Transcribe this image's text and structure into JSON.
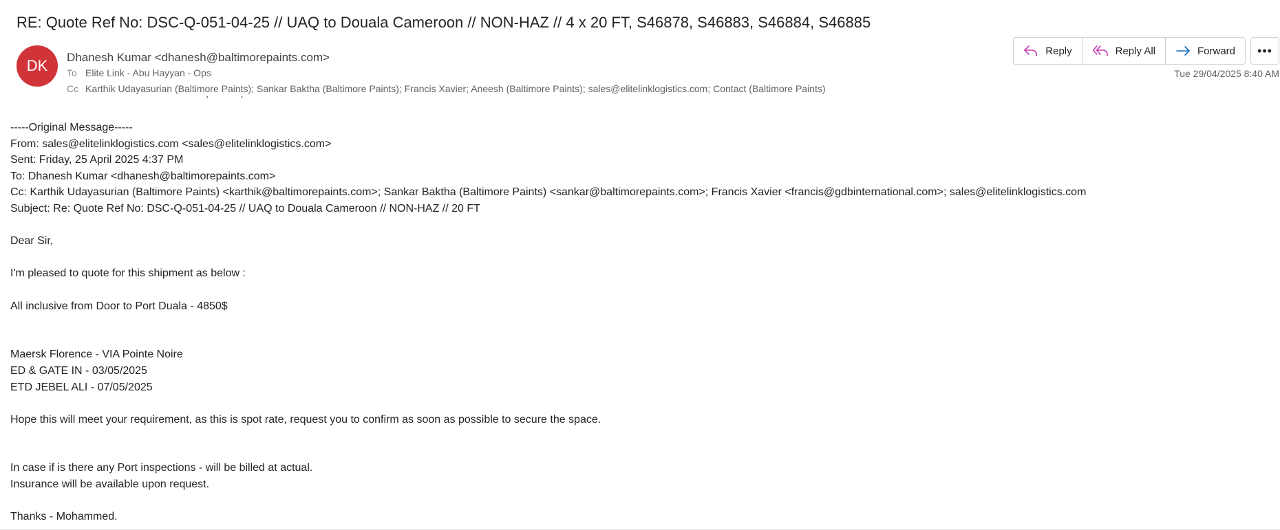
{
  "subject": "RE: Quote Ref No: DSC-Q-051-04-25 // UAQ to Douala Cameroon // NON-HAZ // 4 x 20 FT, S46878, S46883, S46884, S46885",
  "sender": {
    "initials": "DK",
    "avatar_color": "#d13438",
    "display": "Dhanesh Kumar <dhanesh@baltimorepaints.com>"
  },
  "to": {
    "label": "To",
    "value": "Elite Link - Abu Hayyan - Ops"
  },
  "cc": {
    "label": "Cc",
    "value": "Karthik Udayasurian (Baltimore Paints); Sankar Baktha (Baltimore Paints); Francis Xavier; Aneesh (Baltimore Paints); sales@elitelinklogistics.com; Contact (Baltimore Paints)"
  },
  "actions": {
    "reply": "Reply",
    "reply_all": "Reply All",
    "forward": "Forward",
    "more": "•••"
  },
  "timestamp": "Tue 29/04/2025 8:40 AM",
  "body_lines": [
    "-----Original Message-----",
    "From: sales@elitelinklogistics.com <sales@elitelinklogistics.com>",
    "Sent: Friday, 25 April 2025 4:37 PM",
    "To: Dhanesh Kumar <dhanesh@baltimorepaints.com>",
    "Cc: Karthik Udayasurian (Baltimore Paints) <karthik@baltimorepaints.com>; Sankar Baktha (Baltimore Paints) <sankar@baltimorepaints.com>; Francis Xavier <francis@gdbinternational.com>; sales@elitelinklogistics.com",
    "Subject: Re: Quote Ref No: DSC-Q-051-04-25 // UAQ to Douala Cameroon // NON-HAZ // 20 FT",
    "",
    "Dear Sir,",
    "",
    "I'm pleased to quote for this shipment as below :",
    "",
    "All inclusive from Door to Port Duala - 4850$",
    "",
    "",
    "Maersk Florence - VIA Pointe Noire",
    "ED & GATE IN - 03/05/2025",
    "ETD JEBEL ALI - 07/05/2025",
    "",
    "Hope this will meet your requirement, as this is spot rate, request you to confirm as soon as possible to secure the space.",
    "",
    "",
    "In case if is there any Port inspections - will be billed at actual.",
    "Insurance will be available upon request.",
    "",
    "Thanks - Mohammed."
  ],
  "colors": {
    "reply_icon": "#c239b3",
    "forward_icon": "#0f6cbd"
  }
}
